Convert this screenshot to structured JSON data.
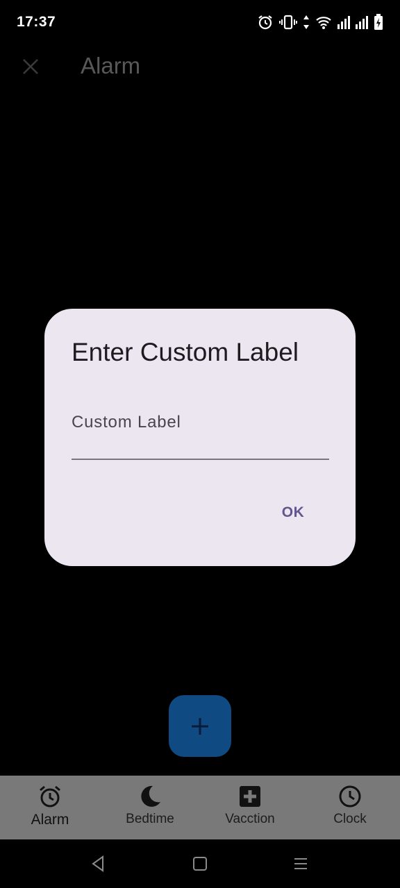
{
  "status_bar": {
    "time": "17:37",
    "icons": [
      "alarm-icon",
      "vibrate-icon",
      "data-arrows-icon",
      "wifi-icon",
      "signal-icon",
      "signal-icon",
      "battery-charging-icon"
    ]
  },
  "app_bar": {
    "title": "Alarm",
    "close_icon": "close-icon"
  },
  "fab": {
    "icon": "plus-icon"
  },
  "bottom_nav": {
    "items": [
      {
        "label": "Alarm",
        "icon": "alarm-clock-icon",
        "active": true
      },
      {
        "label": "Bedtime",
        "icon": "moon-icon",
        "active": false
      },
      {
        "label": "Vacction",
        "icon": "medical-cross-icon",
        "active": false
      },
      {
        "label": "Clock",
        "icon": "clock-icon",
        "active": false
      }
    ]
  },
  "dialog": {
    "title": "Enter Custom Label",
    "field": {
      "label": "Custom Label",
      "value": ""
    },
    "ok_label": "OK"
  },
  "colors": {
    "dialog_bg": "#ece6f0",
    "accent": "#65558f",
    "fab_bg": "#0f4a83",
    "nav_bg": "#797979"
  }
}
